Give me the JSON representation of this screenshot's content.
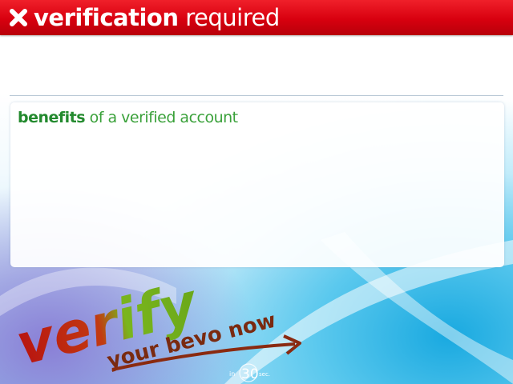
{
  "header": {
    "title_bold": "verification",
    "title_rest": " required",
    "icon": "close-icon"
  },
  "panel": {
    "title_bold": "benefits",
    "title_rest": " of a verified account"
  },
  "promo": {
    "verify_word": "verify",
    "tagline": "your bevo now",
    "badge_prefix": "in",
    "badge_number": "30",
    "badge_suffix": "sec."
  },
  "colors": {
    "header_red": "#d8000f",
    "title_green": "#238a2e",
    "verify_red": "#b8140f",
    "verify_green": "#7ab51d",
    "tagline_brown": "#7a2a10"
  }
}
